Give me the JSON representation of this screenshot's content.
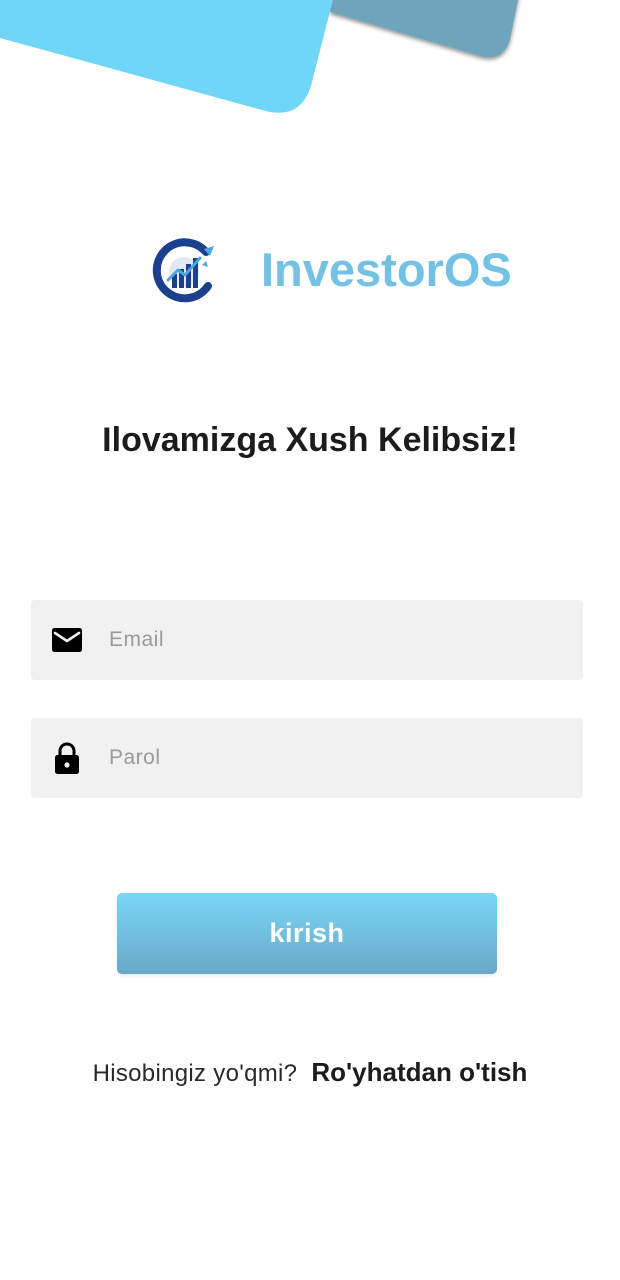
{
  "brand": {
    "name": "InvestorOS",
    "logo_icon": "investor-growth-chart-logo",
    "colors": {
      "text": "#73c1e4",
      "logo_primary": "#1c3f8e",
      "logo_accent": "#4aa8dd"
    }
  },
  "header_decor": {
    "colors": {
      "card_front": "#6fd6f8",
      "card_back": "#6ea5bd"
    }
  },
  "welcome_title": "Ilovamizga Xush Kelibsiz!",
  "form": {
    "email": {
      "placeholder": "Email",
      "value": "",
      "icon": "mail-icon"
    },
    "password": {
      "placeholder": "Parol",
      "value": "",
      "icon": "lock-icon"
    },
    "submit_label": "kirish"
  },
  "signup": {
    "prompt": "Hisobingiz yo'qmi?",
    "link_label": "Ro'yhatdan o'tish"
  },
  "theme": {
    "button_gradient_top": "#79d6f7",
    "button_gradient_bottom": "#6aa8c8",
    "field_background": "#f1f1f1"
  }
}
